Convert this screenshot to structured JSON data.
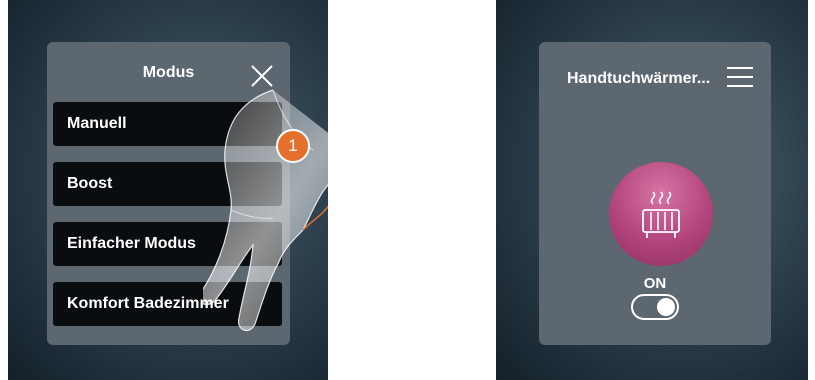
{
  "mode_screen": {
    "title": "Modus",
    "close_icon": "close-icon",
    "modes": [
      {
        "label": "Manuell"
      },
      {
        "label": "Boost"
      },
      {
        "label": "Einfacher Modus"
      },
      {
        "label": "Komfort Badezimmer"
      }
    ],
    "step_badge": "1"
  },
  "device_screen": {
    "name": "Handtuchwärmer...",
    "menu_icon": "hamburger-menu-icon",
    "device_icon": "towel-warmer-icon",
    "status": "ON",
    "toggle_on": true,
    "accent_color": "#b2457c"
  }
}
